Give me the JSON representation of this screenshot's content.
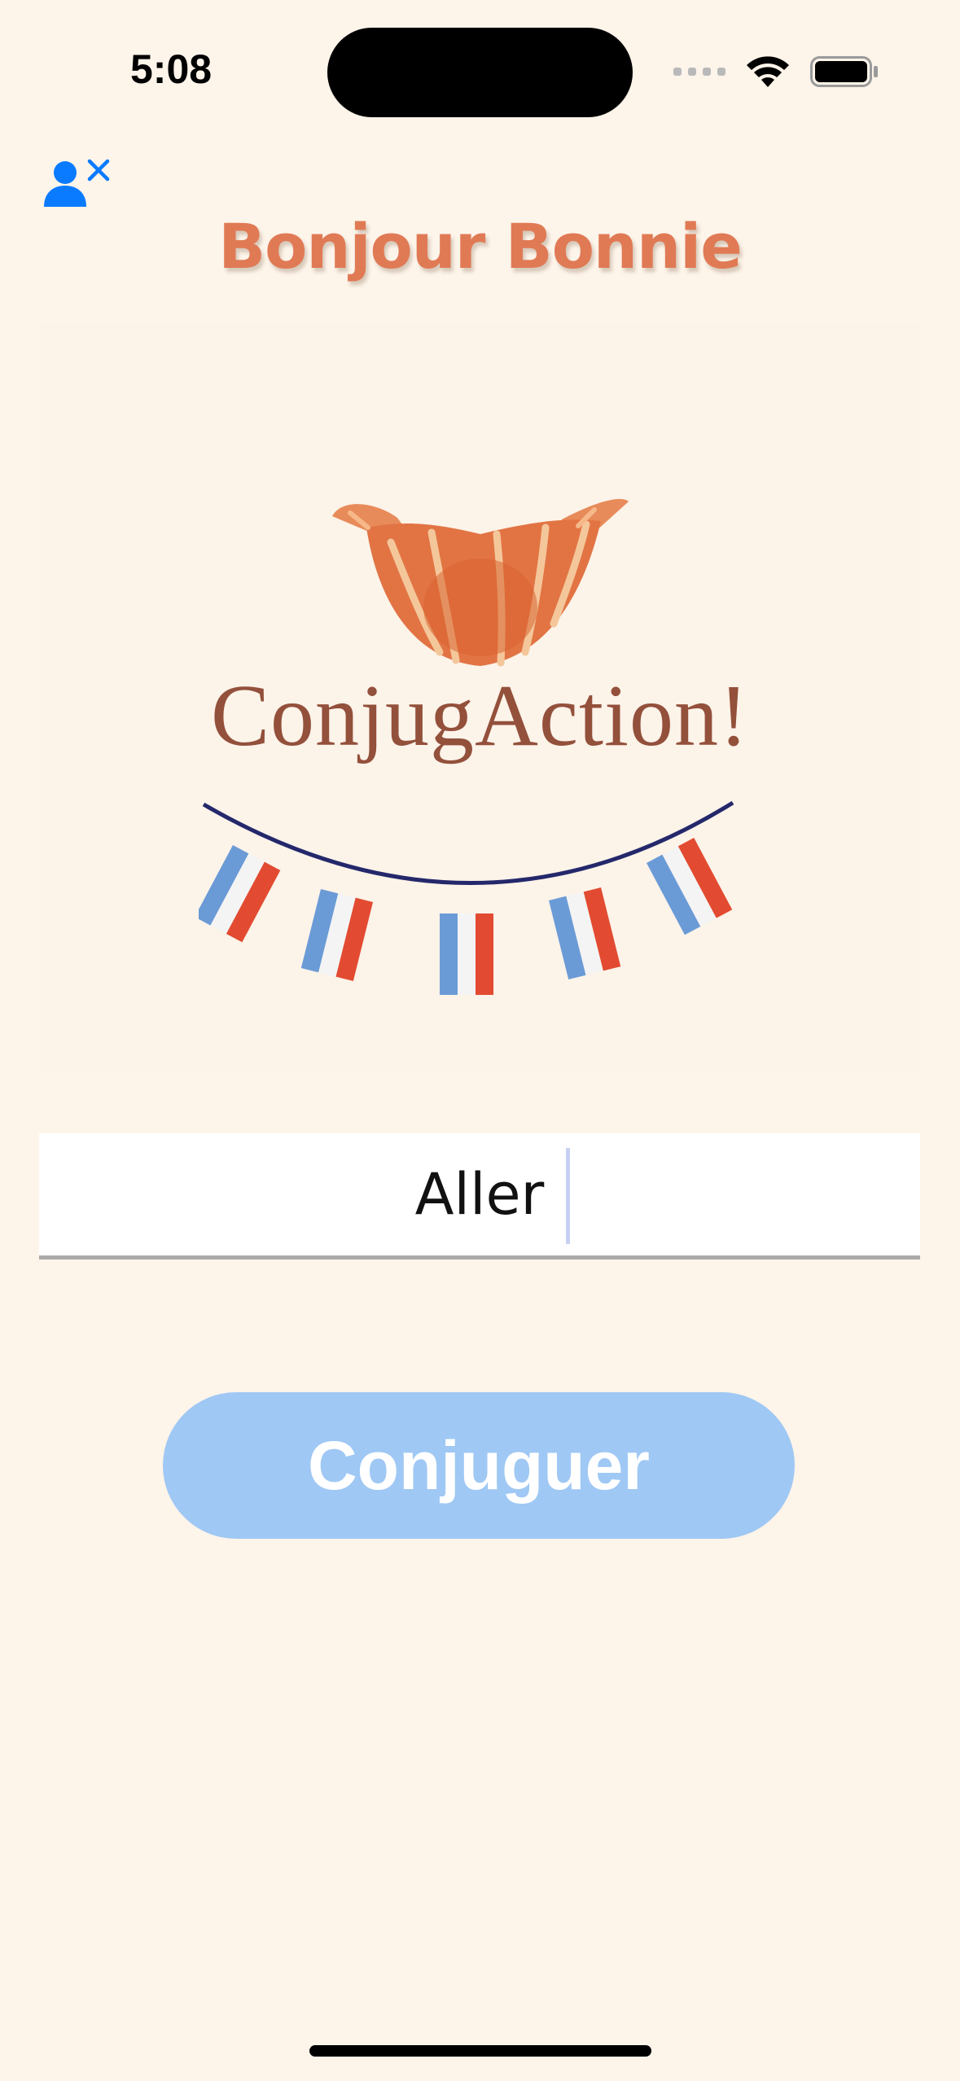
{
  "status_bar": {
    "time": "5:08"
  },
  "header": {
    "logout_icon": "person-remove-icon",
    "greeting": "Bonjour Bonnie"
  },
  "logo": {
    "brand_text": "ConjugAction!",
    "illustrations": [
      "croissant",
      "french-flag-bunting"
    ]
  },
  "verb_input": {
    "value": "Aller"
  },
  "actions": {
    "conjugate_label": "Conjuguer"
  },
  "colors": {
    "background": "#fdf4ea",
    "greeting": "#e07a55",
    "accent_blue": "#0a7bff",
    "button": "#9fc8f4",
    "brand_text": "#93503b"
  }
}
